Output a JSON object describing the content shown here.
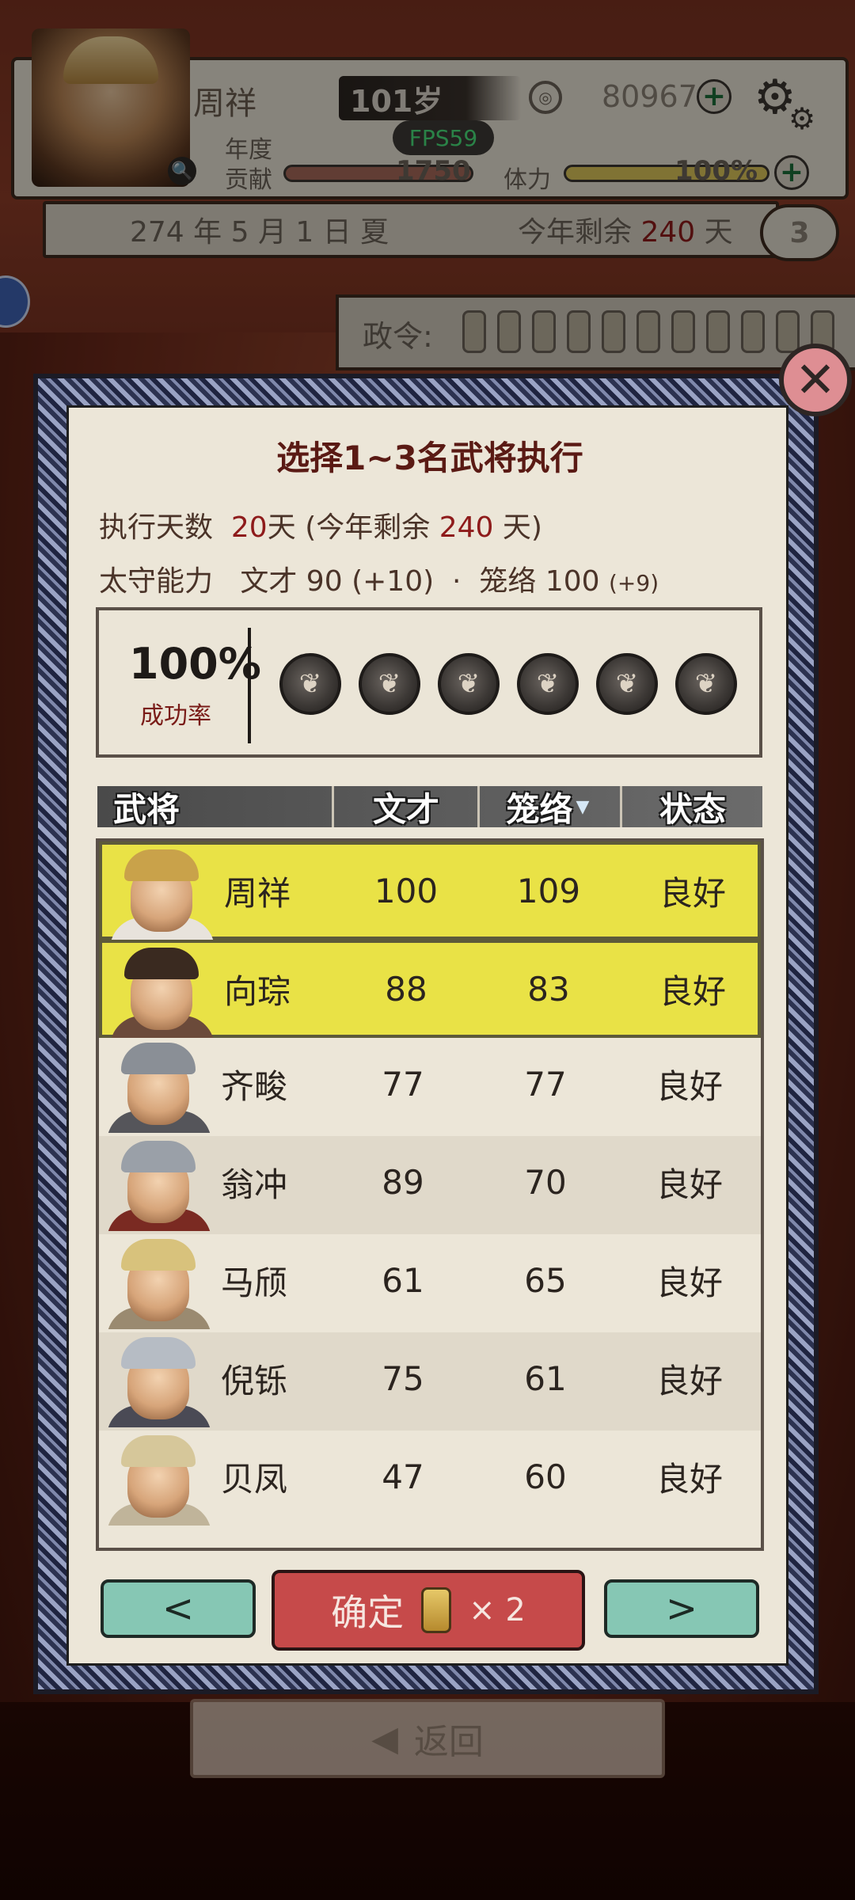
{
  "header": {
    "name": "周祥",
    "age": "101岁",
    "coins": "80967",
    "year_label": "年度",
    "contrib_label": "贡献",
    "contrib_value": "1750",
    "stamina_label": "体力",
    "stamina_value": "100%",
    "fps": "FPS59",
    "contrib_fill": 0.55,
    "stamina_fill": 1.0
  },
  "date_bar": {
    "date": "274 年 5 月 1 日 夏",
    "remain_prefix": "今年剩余",
    "remain_days": "240",
    "remain_suffix": "天",
    "badge": "3"
  },
  "decree": {
    "label": "政令:",
    "token_count": 11
  },
  "dialog": {
    "title": "选择1~3名武将执行",
    "days_label": "执行天数",
    "days_value": "20",
    "days_unit": "天",
    "days_remain_prefix": "(今年剩余",
    "days_remain_value": "240",
    "days_remain_suffix": "天)",
    "ability_label": "太守能力",
    "ability_wen": "文才 90",
    "ability_wen_bonus": "(+10)",
    "ability_sep": "·",
    "ability_long": "笼络 100",
    "ability_long_bonus": "(+9)",
    "success_rate": "100%",
    "success_label": "成功率",
    "fan_icons": [
      "fan-icon",
      "fan-icon",
      "fan-icon",
      "fan-icon",
      "fan-icon",
      "fan-icon"
    ],
    "columns": {
      "general": "武将",
      "wen": "文才",
      "long": "笼络",
      "status": "状态"
    },
    "rows": [
      {
        "name": "周祥",
        "wen": "100",
        "long": "109",
        "status": "良好",
        "selected": true
      },
      {
        "name": "向琮",
        "wen": "88",
        "long": "83",
        "status": "良好",
        "selected": true
      },
      {
        "name": "齐畯",
        "wen": "77",
        "long": "77",
        "status": "良好",
        "selected": false
      },
      {
        "name": "翁冲",
        "wen": "89",
        "long": "70",
        "status": "良好",
        "selected": false
      },
      {
        "name": "马颀",
        "wen": "61",
        "long": "65",
        "status": "良好",
        "selected": false
      },
      {
        "name": "倪铄",
        "wen": "75",
        "long": "61",
        "status": "良好",
        "selected": false
      },
      {
        "name": "贝凤",
        "wen": "47",
        "long": "60",
        "status": "良好",
        "selected": false
      }
    ],
    "prev_label": "<",
    "next_label": ">",
    "confirm_label": "确定",
    "confirm_cost": "× 2"
  },
  "back_label": "返回",
  "colors": {
    "selected_row": "#e9e246",
    "confirm": "#c64a4a",
    "nav": "#86c7b4",
    "title_red": "#5a1a14"
  }
}
